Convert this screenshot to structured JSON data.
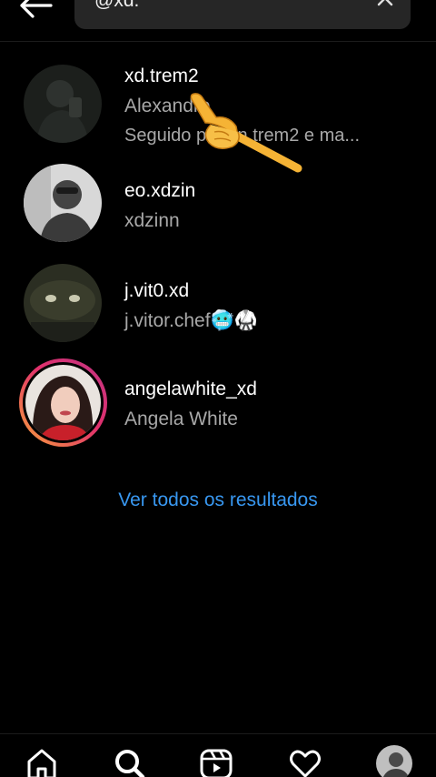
{
  "search": {
    "query": "@xd.",
    "back_icon": "arrow-left-icon",
    "clear_icon": "close-icon"
  },
  "results": [
    {
      "username": "xd.trem2",
      "fullname": "Alexandre",
      "subtitle": "Seguido por bn.trem2 e ma..."
    },
    {
      "username": "eo.xdzin",
      "fullname": "xdzinn"
    },
    {
      "username": "j.vit0.xd",
      "fullname": "j.vitor.chef🥶🥋"
    },
    {
      "username": "angelawhite_xd",
      "fullname": "Angela White",
      "has_story": true
    }
  ],
  "see_all": "Ver todos os resultados",
  "bottom_nav": {
    "items": [
      "home-icon",
      "search-icon",
      "reels-icon",
      "heart-icon",
      "profile-avatar"
    ],
    "active": "search-icon"
  },
  "colors": {
    "background": "#000000",
    "link": "#3897f0",
    "secondary_text": "#a8a8a8"
  }
}
